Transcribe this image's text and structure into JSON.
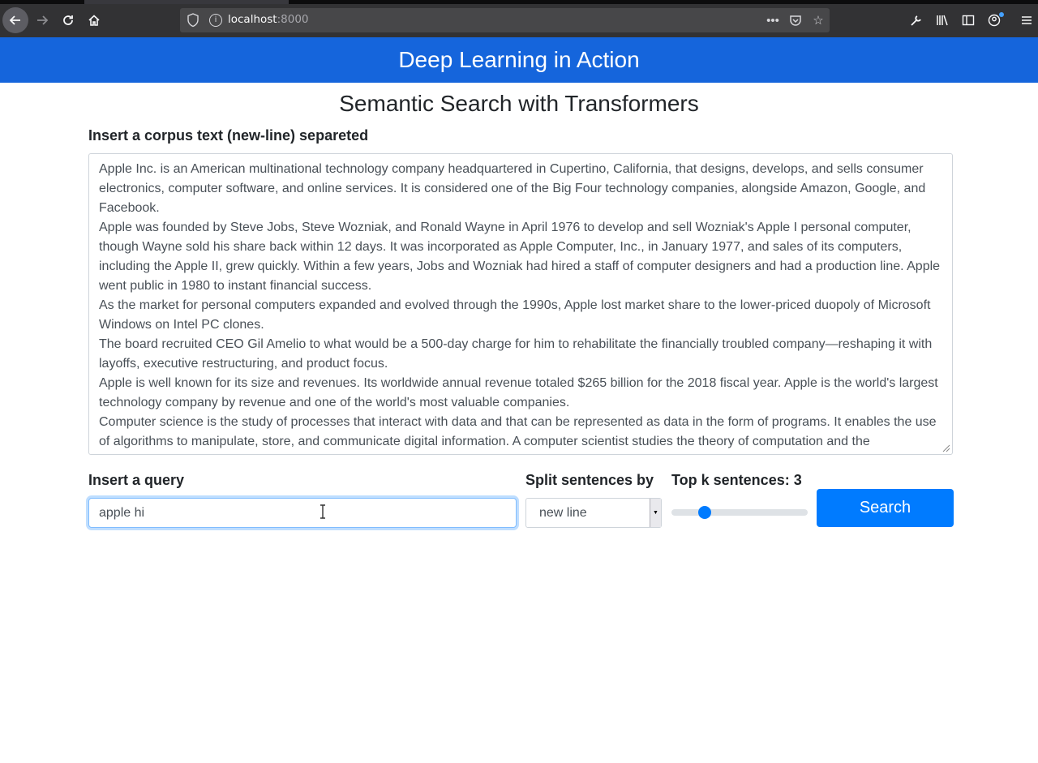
{
  "browser": {
    "url_host": "localhost",
    "url_port": ":8000"
  },
  "app": {
    "header_title": "Deep Learning in Action",
    "page_title": "Semantic Search with Transformers"
  },
  "corpus": {
    "label": "Insert a corpus text (new-line) separeted",
    "lines": [
      "Apple Inc. is an American multinational technology company headquartered in Cupertino, California, that designs, develops, and sells consumer electronics, computer software, and online services. It is considered one of the Big Four technology companies, alongside Amazon, Google, and Facebook.",
      "Apple was founded by Steve Jobs, Steve Wozniak, and Ronald Wayne in April 1976 to develop and sell Wozniak's Apple I personal computer, though Wayne sold his share back within 12 days. It was incorporated as Apple Computer, Inc., in January 1977, and sales of its computers, including the Apple II, grew quickly. Within a few years, Jobs and Wozniak had hired a staff of computer designers and had a production line. Apple went public in 1980 to instant financial success.",
      "As the market for personal computers expanded and evolved through the 1990s, Apple lost market share to the lower-priced duopoly of Microsoft Windows on Intel PC clones.",
      "The board recruited CEO Gil Amelio to what would be a 500-day charge for him to rehabilitate the financially troubled company—reshaping it with layoffs, executive restructuring, and product focus.",
      "Apple is well known for its size and revenues. Its worldwide annual revenue totaled $265 billion for the 2018 fiscal year. Apple is the world's largest technology company by revenue and one of the world's most valuable companies.",
      "Computer science is the study of processes that interact with data and that can be represented as data in the form of programs. It enables the use of algorithms to manipulate, store, and communicate digital information. A computer scientist studies the theory of computation and the"
    ]
  },
  "query": {
    "label": "Insert a query",
    "value": "apple hi"
  },
  "split": {
    "label": "Split sentences by",
    "selected": "new line"
  },
  "topk": {
    "label": "Top k sentences: 3",
    "value": 3
  },
  "search_button": {
    "label": "Search",
    "color": "#007bff"
  },
  "colors": {
    "header_bg": "#1565dc",
    "accent": "#007bff"
  }
}
